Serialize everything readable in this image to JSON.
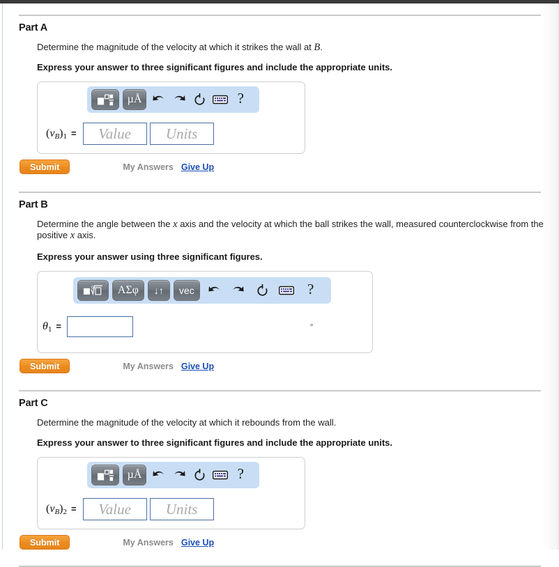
{
  "theme": {
    "toolbar_bg": "#c9def5",
    "button_grey": "#6f757c",
    "submit_orange": "#ef8f22",
    "link_blue": "#1a4fb4",
    "field_border": "#4a6fa5",
    "muted_grey": "#8c8c8c",
    "placeholder_grey": "#a9a9a9"
  },
  "actions": {
    "submit_label": "Submit",
    "my_answers_label": "My Answers",
    "give_up_label": "Give Up"
  },
  "toolbar_icons": {
    "template_label": "■",
    "superscript_label": "□",
    "units_label": "µÅ",
    "nthroot_label": "√",
    "greek_label": "ΑΣφ",
    "arrows_label": "↓↑",
    "vector_label": "vec",
    "undo_label": "undo",
    "redo_label": "redo",
    "reset_label": "reset",
    "keyboard_label": "keyboard",
    "help_label": "?"
  },
  "parts": [
    {
      "id": "part-a",
      "title": "Part A",
      "question_pre": "Determine the magnitude of the velocity at which it strikes the wall at ",
      "question_var": "B",
      "question_post": ".",
      "question_line2": "",
      "instruction": "Express your answer to three significant figures and include the appropriate units.",
      "toolbar_type": "units",
      "answer_label_base": "v",
      "answer_label_sub": "B",
      "answer_label_index": "1",
      "equals": "=",
      "value_placeholder": "Value",
      "units_placeholder": "Units",
      "unit_suffix": ""
    },
    {
      "id": "part-b",
      "title": "Part B",
      "question_pre": "Determine the angle between the ",
      "question_var": "x",
      "question_post": " axis and the velocity at which the ball strikes the wall, measured counterclockwise from the positive ",
      "question_var2": "x",
      "question_post2": " axis.",
      "instruction": "Express your answer using three significant figures.",
      "toolbar_type": "symbolic",
      "answer_label_base": "θ",
      "answer_label_index": "1",
      "equals": "=",
      "field_value": "",
      "unit_suffix": "°"
    },
    {
      "id": "part-c",
      "title": "Part C",
      "question_pre": "Determine the magnitude of the velocity at which it rebounds from the wall.",
      "question_var": "",
      "question_post": "",
      "instruction": "Express your answer to three significant figures and include the appropriate units.",
      "toolbar_type": "units",
      "answer_label_base": "v",
      "answer_label_sub": "B",
      "answer_label_index": "2",
      "equals": "=",
      "value_placeholder": "Value",
      "units_placeholder": "Units",
      "unit_suffix": ""
    }
  ]
}
